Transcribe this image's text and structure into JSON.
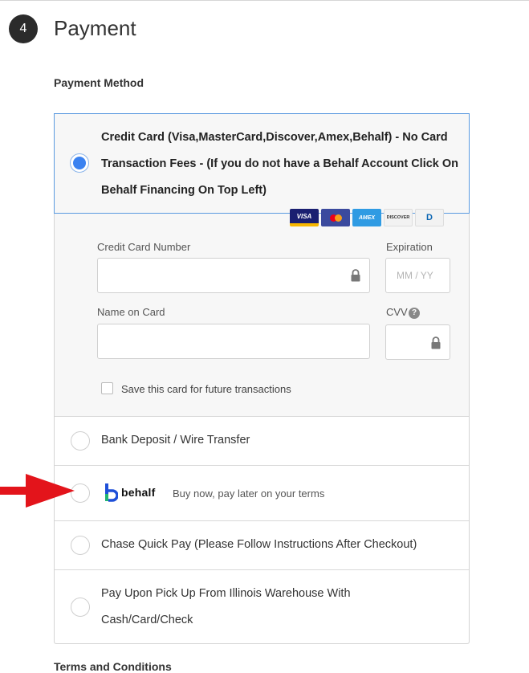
{
  "step": {
    "number": "4",
    "title": "Payment"
  },
  "payment_method_heading": "Payment Method",
  "credit_card_option": {
    "label": "Credit Card (Visa,MasterCard,Discover,Amex,Behalf) - No Card Transaction Fees - (If you do not have a Behalf Account Click On Behalf Financing On Top Left)",
    "selected": true,
    "card_logos": [
      "visa",
      "mastercard",
      "amex",
      "discover",
      "diners-club"
    ],
    "logo_text": {
      "visa": "VISA",
      "amex": "AMEX",
      "discover": "DISCOVER",
      "diners": "D"
    }
  },
  "card_form": {
    "card_number_label": "Credit Card Number",
    "card_number_value": "",
    "expiration_label": "Expiration",
    "expiration_placeholder": "MM / YY",
    "name_label": "Name on Card",
    "name_value": "",
    "cvv_label": "CVV",
    "cvv_help": "?",
    "save_card_label": "Save this card for future transactions",
    "save_card_checked": false
  },
  "other_options": {
    "bank": {
      "label": "Bank Deposit / Wire Transfer",
      "selected": false
    },
    "behalf": {
      "logo_text": "behalf",
      "tagline": "Buy now, pay later on your terms",
      "selected": false
    },
    "chase": {
      "label": "Chase Quick Pay (Please Follow Instructions After Checkout)",
      "selected": false
    },
    "pickup": {
      "label_line1": "Pay Upon Pick Up From Illinois Warehouse With",
      "label_line2": "Cash/Card/Check",
      "selected": false
    }
  },
  "terms_heading": "Terms and Conditions",
  "colors": {
    "accent_blue": "#3b82f0",
    "arrow_red": "#e3141b",
    "selected_border": "#5a9ae0"
  }
}
